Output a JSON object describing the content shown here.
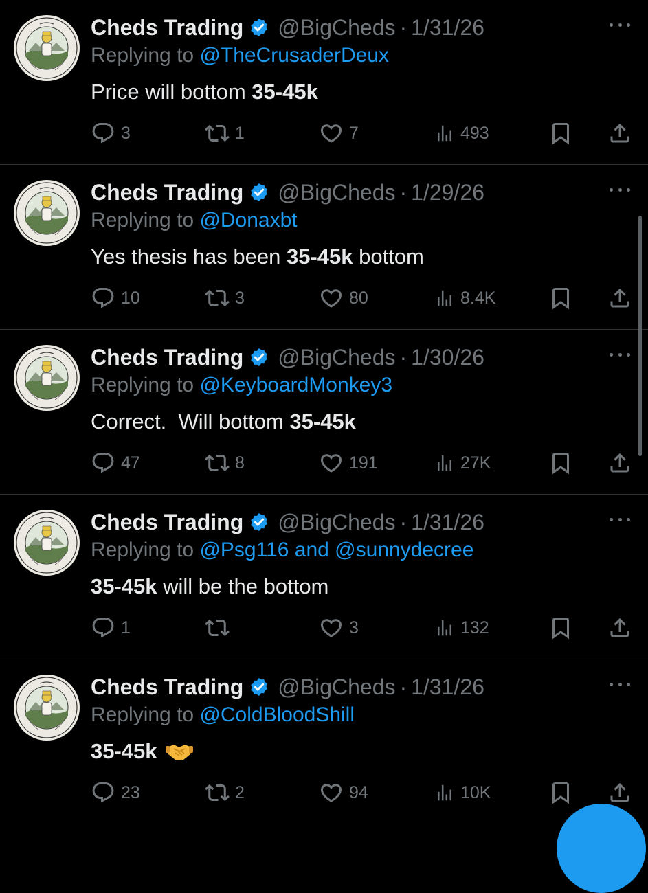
{
  "colors": {
    "background": "#000000",
    "text": "#e7e9ea",
    "muted": "#71767b",
    "link": "#1d9bf0",
    "divider": "#2f3336",
    "fab": "#1d9bf0"
  },
  "icons": {
    "reply": "reply-icon",
    "retweet": "retweet-icon",
    "like": "heart-icon",
    "views": "views-icon",
    "bookmark": "bookmark-icon",
    "share": "share-icon",
    "more": "more-dots-icon",
    "verified": "verified-badge-icon"
  },
  "tweets": [
    {
      "name": "Cheds Trading",
      "handle": "@BigCheds",
      "separator": "·",
      "date": "1/31/26",
      "replying_prefix": "Replying to",
      "mention1": "@TheCrusaderDeux",
      "and": "",
      "mention2": "",
      "text_pre": "Price will bottom ",
      "text_bold": "35-45k",
      "text_post": "",
      "emoji": false,
      "replies": "3",
      "retweets": "1",
      "likes": "7",
      "views": "493"
    },
    {
      "name": "Cheds Trading",
      "handle": "@BigCheds",
      "separator": "·",
      "date": "1/29/26",
      "replying_prefix": "Replying to",
      "mention1": "@Donaxbt",
      "and": "",
      "mention2": "",
      "text_pre": "Yes thesis has been ",
      "text_bold": "35-45k",
      "text_post": " bottom",
      "emoji": false,
      "replies": "10",
      "retweets": "3",
      "likes": "80",
      "views": "8.4K"
    },
    {
      "name": "Cheds Trading",
      "handle": "@BigCheds",
      "separator": "·",
      "date": "1/30/26",
      "replying_prefix": "Replying to",
      "mention1": "@KeyboardMonkey3",
      "and": "",
      "mention2": "",
      "text_pre": "Correct.  Will bottom ",
      "text_bold": "35-45k",
      "text_post": "",
      "emoji": false,
      "replies": "47",
      "retweets": "8",
      "likes": "191",
      "views": "27K"
    },
    {
      "name": "Cheds Trading",
      "handle": "@BigCheds",
      "separator": "·",
      "date": "1/31/26",
      "replying_prefix": "Replying to",
      "mention1": "@Psg116",
      "and": " and ",
      "mention2": "@sunnydecree",
      "text_pre": "",
      "text_bold": "35-45k",
      "text_post": " will be the bottom",
      "emoji": false,
      "replies": "1",
      "retweets": "",
      "likes": "3",
      "views": "132"
    },
    {
      "name": "Cheds Trading",
      "handle": "@BigCheds",
      "separator": "·",
      "date": "1/31/26",
      "replying_prefix": "Replying to",
      "mention1": "@ColdBloodShill",
      "and": "",
      "mention2": "",
      "text_pre": "",
      "text_bold": "35-45k",
      "text_post": "",
      "emoji": true,
      "replies": "23",
      "retweets": "2",
      "likes": "94",
      "views": "10K"
    }
  ]
}
